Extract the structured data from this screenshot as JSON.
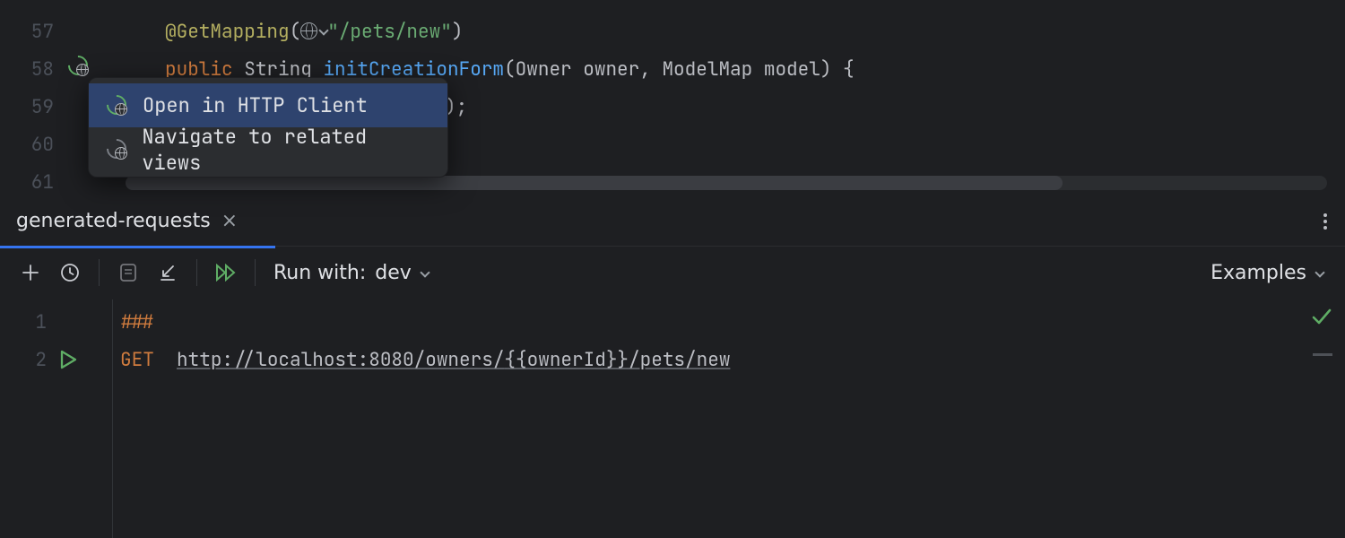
{
  "editor_top": {
    "lines": {
      "57": 57,
      "58": 58,
      "59": 59,
      "60": 60,
      "61": 61
    },
    "code": {
      "l57_ann": "@GetMapping",
      "l57_p1": "(",
      "l57_str": "\"/pets/new\"",
      "l57_p2": ")",
      "l58_kw": "public",
      "l58_cls": "String",
      "l58_mth": "initCreationForm",
      "l58_sig": "(Owner owner, ModelMap model) {",
      "l59_tail": ");"
    }
  },
  "popup": {
    "item1": "Open in HTTP Client",
    "item2": "Navigate to related views"
  },
  "tab": {
    "title": "generated-requests",
    "close": "×"
  },
  "toolbar": {
    "run_with_label": "Run with:",
    "run_with_value": "dev",
    "examples": "Examples"
  },
  "editor_bottom": {
    "lines": {
      "1": 1,
      "2": 2
    },
    "l1_hash": "###",
    "l2_method": "GET",
    "l2_url_pre": "http://localhost:8080/owners/",
    "l2_url_var": "{{ownerId}}",
    "l2_url_post": "/pets/new",
    "check": "✓"
  }
}
